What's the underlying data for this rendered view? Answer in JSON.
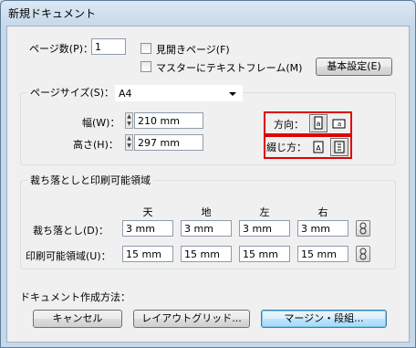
{
  "window": {
    "title": "新規ドキュメント"
  },
  "pages": {
    "label": "ページ数(P)：",
    "value": "1"
  },
  "facing": {
    "label": "見開きページ(F)"
  },
  "master_text": {
    "label": "マスターにテキストフレーム(M)"
  },
  "basic_settings": {
    "label": "基本設定(E)"
  },
  "page_size": {
    "label": "ページサイズ(S)：",
    "value": "A4"
  },
  "width": {
    "label": "幅(W)：",
    "value": "210 mm"
  },
  "height": {
    "label": "高さ(H)：",
    "value": "297 mm"
  },
  "orientation": {
    "label": "方向："
  },
  "binding": {
    "label": "綴じ方："
  },
  "bleed_group": {
    "title": "裁ち落としと印刷可能領域"
  },
  "columns": [
    "天",
    "地",
    "左",
    "右"
  ],
  "bleed": {
    "label": "裁ち落とし(D)：",
    "values": [
      "3 mm",
      "3 mm",
      "3 mm",
      "3 mm"
    ]
  },
  "slug": {
    "label": "印刷可能領域(U)：",
    "values": [
      "15 mm",
      "15 mm",
      "15 mm",
      "15 mm"
    ]
  },
  "create_method": {
    "label": "ドキュメント作成方法："
  },
  "buttons": {
    "cancel": "キャンセル",
    "layout_grid": "レイアウトグリッド...",
    "margin": "マージン・段組..."
  },
  "icons": {
    "spin_up": "spin-up-icon",
    "spin_down": "spin-down-icon",
    "portrait": "portrait-page-icon",
    "landscape": "landscape-page-icon",
    "bind_left": "bind-left-icon",
    "bind_right": "bind-right-icon",
    "chain": "chain-link-icon"
  },
  "colors": {
    "highlight": "#e00000",
    "default_button": "#3c7fb1"
  }
}
